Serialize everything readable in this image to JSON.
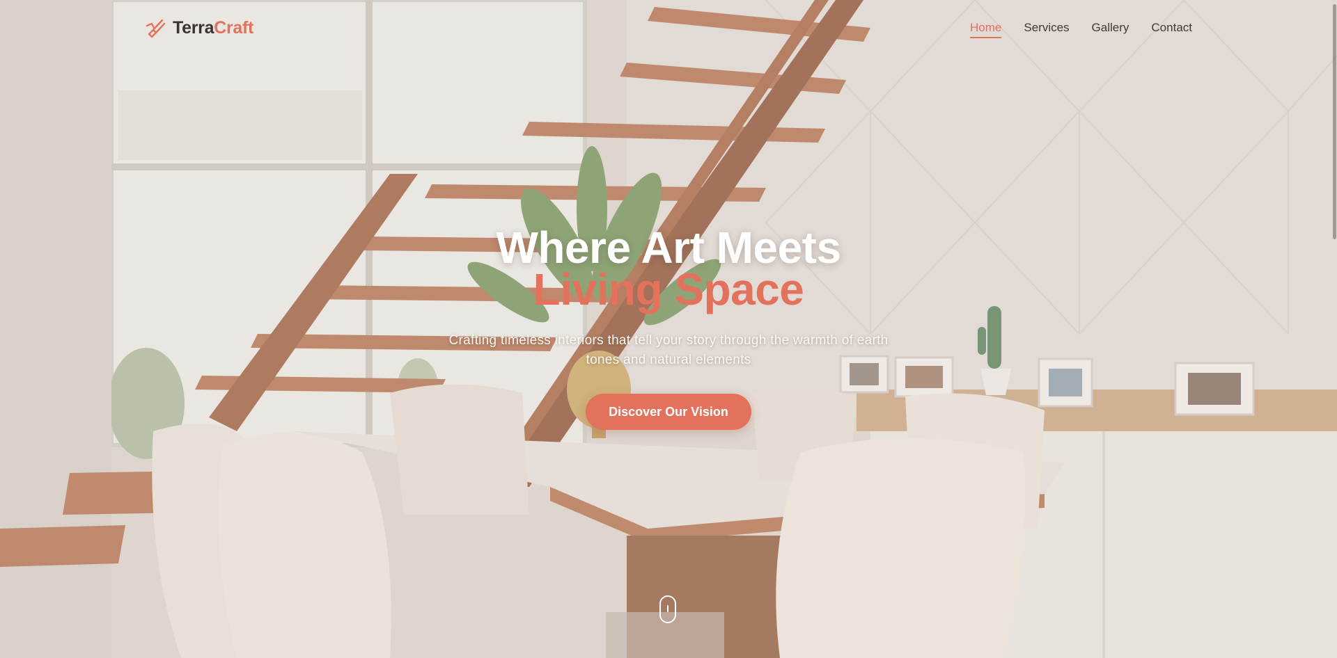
{
  "brand": {
    "name_part1": "Terra",
    "name_part2": "Craft",
    "icon": "paintbrush-icon"
  },
  "nav": {
    "items": [
      {
        "label": "Home",
        "active": true
      },
      {
        "label": "Services",
        "active": false
      },
      {
        "label": "Gallery",
        "active": false
      },
      {
        "label": "Contact",
        "active": false
      }
    ]
  },
  "hero": {
    "title_line1": "Where Art Meets",
    "title_line2": "Living Space",
    "subtitle": "Crafting timeless interiors that tell your story through the warmth of earth tones and natural elements",
    "cta_label": "Discover Our Vision"
  },
  "scroll_indicator": {
    "icon": "mouse-scroll-icon"
  },
  "colors": {
    "accent": "#e3725c",
    "text_dark": "#3a3431",
    "hero_text": "#ffffff"
  }
}
